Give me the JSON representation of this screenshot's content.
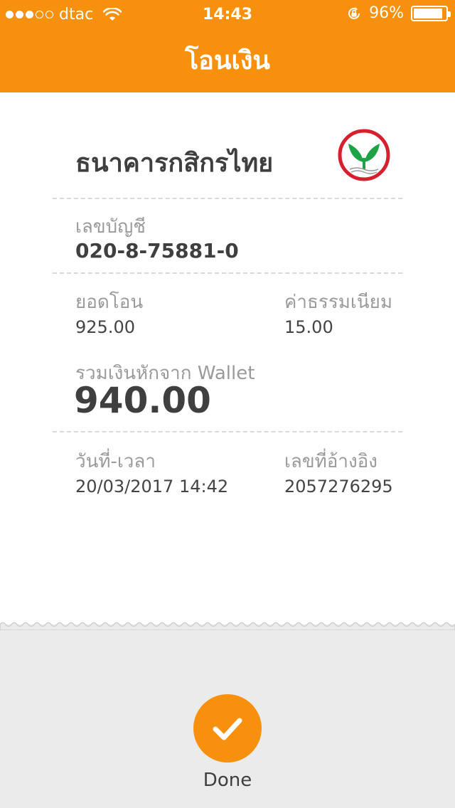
{
  "status_bar": {
    "carrier": "dtac",
    "time": "14:43",
    "battery": "96%",
    "battery_level": 0.96
  },
  "header": {
    "title": "โอนเงิน"
  },
  "receipt": {
    "bank_name": "ธนาคารกสิกรไทย",
    "account_label": "เลขบัญชี",
    "account_number": "020-8-75881-0",
    "amount_label": "ยอดโอน",
    "amount_value": "925.00",
    "fee_label": "ค่าธรรมเนียม",
    "fee_value": "15.00",
    "total_label": "รวมเงินหักจาก Wallet",
    "total_value": "940.00",
    "datetime_label": "วันที่-เวลา",
    "datetime_value": "20/03/2017 14:42",
    "reference_label": "เลขที่อ้างอิง",
    "reference_value": "2057276295"
  },
  "actions": {
    "done_label": "Done"
  },
  "colors": {
    "accent": "#F7900C",
    "bank_green": "#1BA345",
    "bank_red": "#D6202D",
    "bottom_bg": "#EBEBEB"
  }
}
